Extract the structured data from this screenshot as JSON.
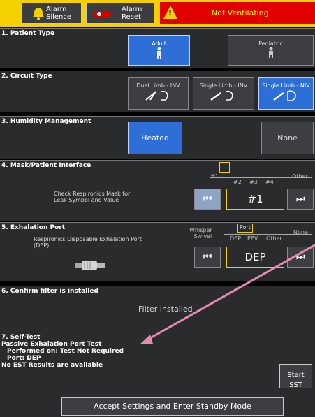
{
  "topbar": {
    "alarm_silence": "Alarm Silence",
    "alarm_silence_l1": "Alarm",
    "alarm_silence_l2": "Silence",
    "alarm_reset_l1": "Alarm",
    "alarm_reset_l2": "Reset",
    "alarm_status": "Not Ventilating",
    "warning_symbol": "!"
  },
  "sections": {
    "patient_type": {
      "title": "1. Patient Type",
      "options": [
        "Adult",
        "Pediatric"
      ],
      "selected": "Adult"
    },
    "circuit_type": {
      "title": "2. Circuit Type",
      "options": [
        "Dual Limb - INV",
        "Single Limb - INV",
        "Single Limb - NIV"
      ],
      "selected": "Single Limb - NIV"
    },
    "humidity": {
      "title": "3. Humidity Management",
      "options": [
        "Heated",
        "None"
      ],
      "selected": "Heated"
    },
    "mask": {
      "title": "4. Mask/Patient Interface",
      "description": "Check Respironics Mask for Leak Symbol and Value",
      "desc_l1": "Check Respironics Mask for",
      "desc_l2": "Leak Symbol and Value",
      "scale": [
        "#1",
        "#2",
        "#3",
        "#4",
        "Other"
      ],
      "value": "#1"
    },
    "exhalation": {
      "title": "5. Exhalation Port",
      "description": "Respironics Disposable Exhalation Port (DEP)",
      "desc_l1": "Respironics Disposable Exhalation Port",
      "desc_l2": "(DEP)",
      "scale_left": "Whisper Swivel",
      "scale_left_l1": "Whisper",
      "scale_left_l2": "Swivel",
      "scale": [
        "Port",
        "DEP",
        "PEV",
        "Other",
        "None"
      ],
      "value": "DEP"
    },
    "filter": {
      "title": "6. Confirm filter is installed",
      "status": "Filter Installed"
    },
    "self_test": {
      "title": "7. Self-Test",
      "line1": "Passive Exhalation Port Test",
      "line2": "Performed on: Test Not Required",
      "line3": "Port: DEP",
      "line4": "No EST Results are available",
      "button": "Start SST",
      "button_l1": "Start",
      "button_l2": "SST"
    }
  },
  "footer": {
    "accept": "Accept Settings and Enter Standby Mode"
  },
  "colors": {
    "frame": "#f5d000",
    "panel": "#2a2b2d",
    "selected": "#2d6fd6",
    "alarm": "#e00000",
    "annotation": "#e88ab0"
  },
  "icons": {
    "bell": "bell-icon",
    "alarm_reset": "alarm-reset-icon",
    "warning": "warning-icon",
    "adult": "person-icon",
    "pediatric": "person-icon",
    "circuit": "circuit-icon",
    "prev": "skip-previous-icon",
    "next": "skip-next-icon",
    "port": "exhalation-port-icon"
  }
}
